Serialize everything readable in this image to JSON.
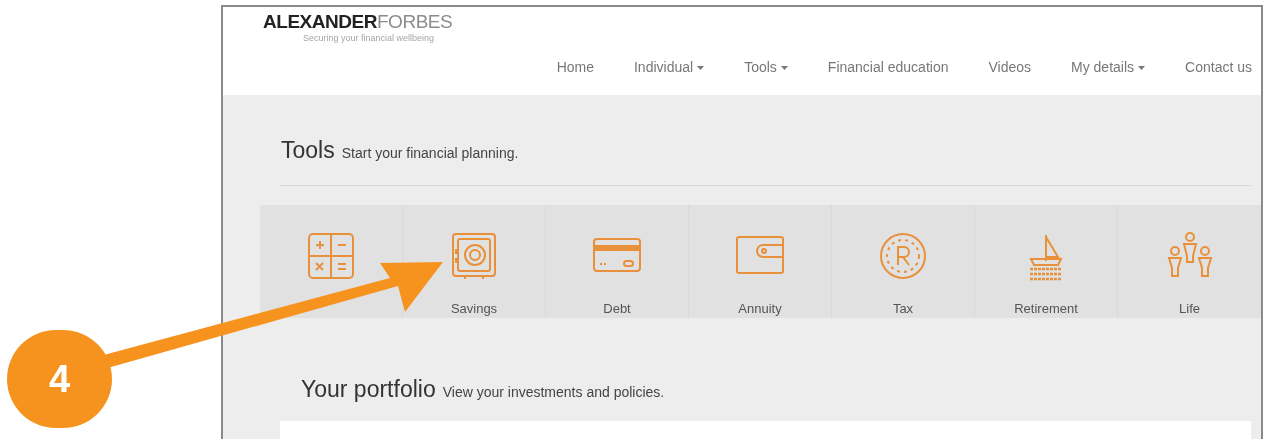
{
  "logo": {
    "brand_first": "ALEXANDER",
    "brand_second": "FORBES",
    "tagline": "Securing your financial wellbeing"
  },
  "nav": [
    {
      "label": "Home",
      "dropdown": false
    },
    {
      "label": "Individual",
      "dropdown": true
    },
    {
      "label": "Tools",
      "dropdown": true
    },
    {
      "label": "Financial education",
      "dropdown": false
    },
    {
      "label": "Videos",
      "dropdown": false
    },
    {
      "label": "My details",
      "dropdown": true
    },
    {
      "label": "Contact us",
      "dropdown": false
    }
  ],
  "tools_section": {
    "title": "Tools",
    "subtitle": "Start your financial planning."
  },
  "tools": [
    {
      "kind": "calculator"
    },
    {
      "kind": "safe",
      "label": "Savings"
    },
    {
      "kind": "card",
      "label": "Debt"
    },
    {
      "kind": "wallet",
      "label": "Annuity"
    },
    {
      "kind": "coin",
      "label": "Tax"
    },
    {
      "kind": "boat",
      "label": "Retirement"
    },
    {
      "kind": "people",
      "label": "Life"
    }
  ],
  "portfolio_section": {
    "title": "Your portfolio",
    "subtitle": "View your investments and policies."
  },
  "annotation": {
    "number": "4"
  }
}
